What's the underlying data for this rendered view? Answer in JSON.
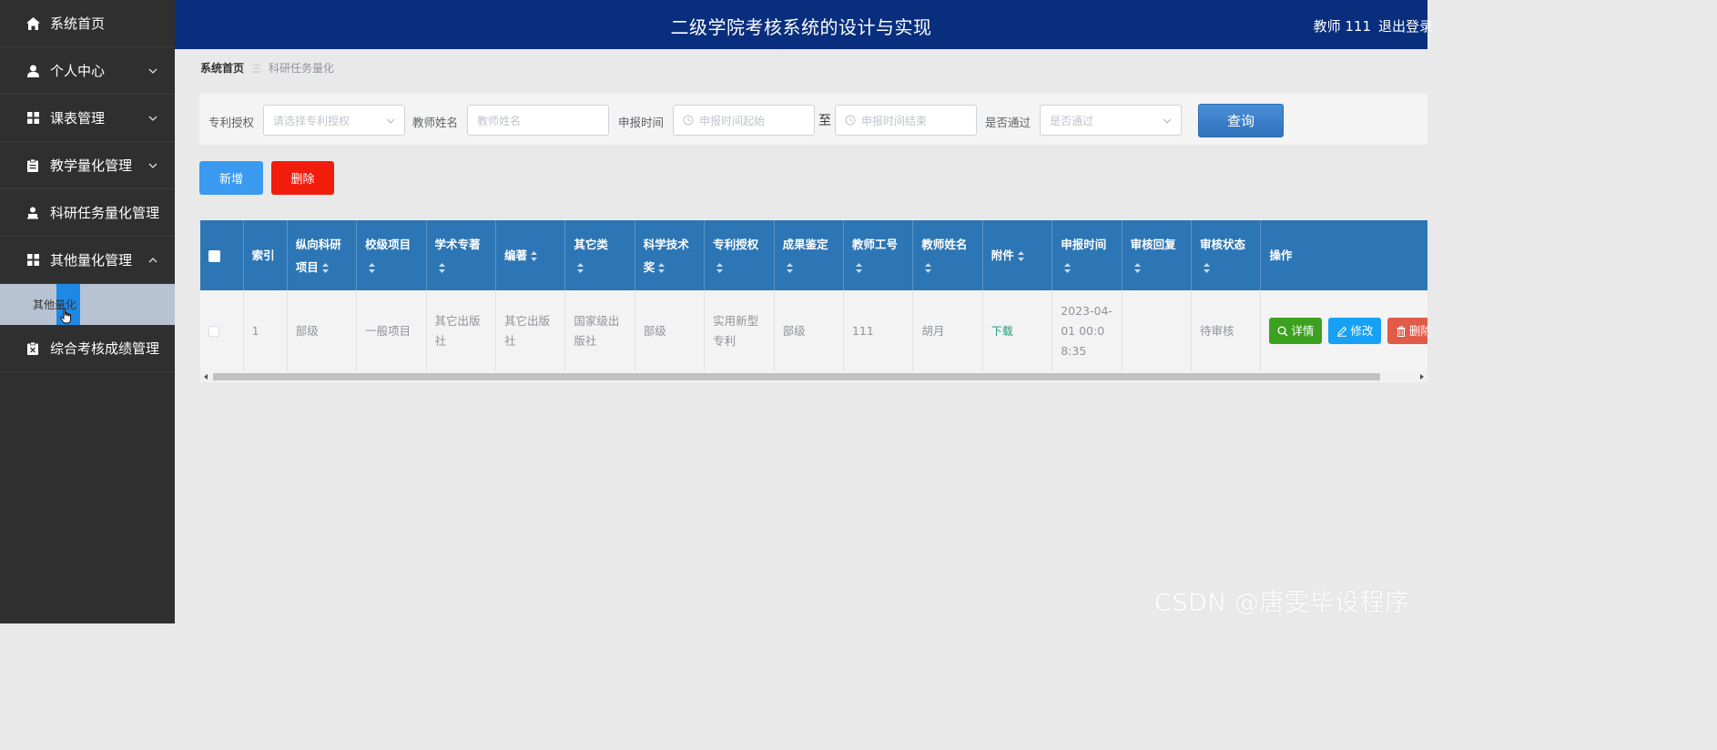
{
  "app": {
    "title": "二级学院考核系统的设计与实现",
    "user": "教师 111",
    "logout": "退出登录"
  },
  "colors": {
    "header_bg": "#082e7d",
    "sidebar_bg": "#2f2f2f",
    "table_header_bg": "#2c76b5",
    "primary": "#3a9af0",
    "danger": "#f21c0d",
    "success": "#3ba11e"
  },
  "sidebar": {
    "items": [
      {
        "label": "系统首页",
        "icon": "home-icon"
      },
      {
        "label": "个人中心",
        "icon": "user-icon"
      },
      {
        "label": "课表管理",
        "icon": "grid-icon"
      },
      {
        "label": "教学量化管理",
        "icon": "clipboard-icon"
      },
      {
        "label": "科研任务量化管理",
        "icon": "person-icon"
      },
      {
        "label": "其他量化管理",
        "icon": "grid-icon"
      },
      {
        "label": "综合考核成绩管理",
        "icon": "document-icon"
      }
    ],
    "submenu": {
      "label": "其他量化"
    }
  },
  "breadcrumb": {
    "home": "系统首页",
    "separator": "三",
    "current": "科研任务量化"
  },
  "search": {
    "patent_label": "专利授权",
    "patent_placeholder": "请选择专利授权",
    "teacher_label": "教师姓名",
    "teacher_placeholder": "教师姓名",
    "date_label": "申报时间",
    "date_start_placeholder": "申报时间起始",
    "date_sep": "至",
    "date_end_placeholder": "申报时间结束",
    "pass_label": "是否通过",
    "pass_placeholder": "是否通过",
    "query_button": "查询"
  },
  "actions": {
    "add": "新增",
    "delete": "删除"
  },
  "table": {
    "headers": {
      "index": "索引",
      "vertical_project": "纵向科研项目",
      "school_project": "校级项目",
      "monograph": "学术专著",
      "compilation": "编著",
      "other": "其它类",
      "sci_award": "科学技术奖",
      "patent": "专利授权",
      "appraisal": "成果鉴定",
      "teacher_id": "教师工号",
      "teacher_name": "教师姓名",
      "attachment": "附件",
      "apply_time": "申报时间",
      "review_reply": "审核回复",
      "review_status": "审核状态",
      "ops": "操作"
    },
    "rows": [
      {
        "index": "1",
        "vertical_project": "部级",
        "school_project": "一般项目",
        "monograph": "其它出版社",
        "compilation": "其它出版社",
        "other": "国家级出版社",
        "sci_award": "部级",
        "patent": "实用新型专利",
        "appraisal": "部级",
        "teacher_id": "111",
        "teacher_name": "胡月",
        "attachment": "下载",
        "apply_time": "2023-04-01 00:08:35",
        "review_reply": "",
        "review_status": "待审核",
        "ops": {
          "detail": "详情",
          "edit": "修改",
          "delete": "删除"
        }
      }
    ]
  },
  "watermark": "CSDN @唐雯毕设程序"
}
